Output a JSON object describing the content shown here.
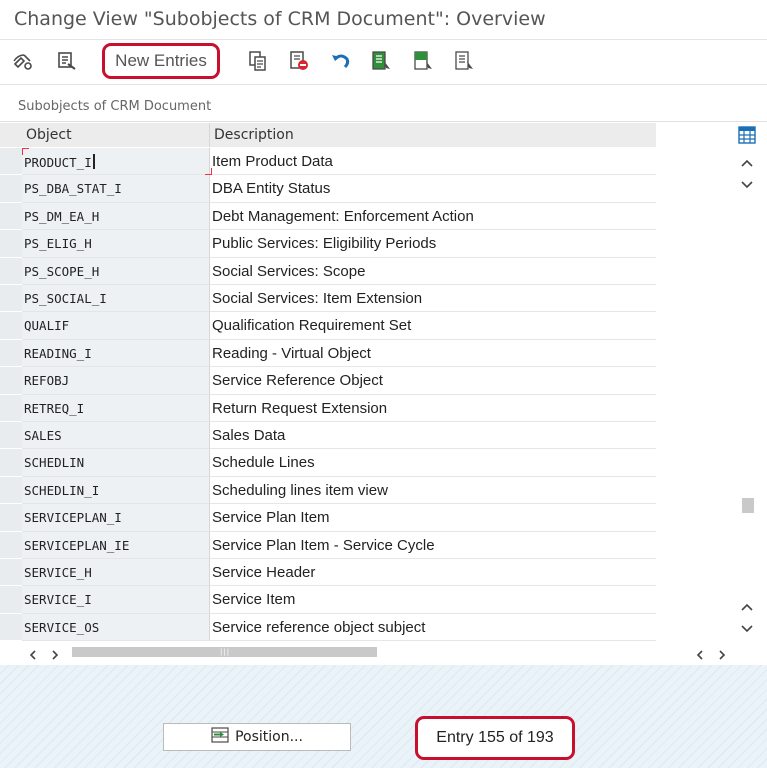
{
  "title": "Change View \"Subobjects of CRM Document\": Overview",
  "toolbar": {
    "new_entries_label": "New Entries",
    "icons": [
      "display-change-icon",
      "select-icon",
      "copy-icon",
      "delete-icon",
      "undo-icon",
      "select-all-icon",
      "select-block-icon",
      "deselect-all-icon"
    ]
  },
  "panel": {
    "title": "Subobjects of CRM Document",
    "columns": [
      "Object",
      "Description"
    ],
    "rows": [
      {
        "object": "PRODUCT_I",
        "description": "Item Product Data"
      },
      {
        "object": "PS_DBA_STAT_I",
        "description": "DBA Entity Status"
      },
      {
        "object": "PS_DM_EA_H",
        "description": "Debt Management: Enforcement Action"
      },
      {
        "object": "PS_ELIG_H",
        "description": "Public Services: Eligibility Periods"
      },
      {
        "object": "PS_SCOPE_H",
        "description": "Social Services: Scope"
      },
      {
        "object": "PS_SOCIAL_I",
        "description": "Social Services: Item Extension"
      },
      {
        "object": "QUALIF",
        "description": "Qualification Requirement Set"
      },
      {
        "object": "READING_I",
        "description": "Reading - Virtual Object"
      },
      {
        "object": "REFOBJ",
        "description": "Service Reference Object"
      },
      {
        "object": "RETREQ_I",
        "description": "Return Request Extension"
      },
      {
        "object": "SALES",
        "description": "Sales Data"
      },
      {
        "object": "SCHEDLIN",
        "description": "Schedule Lines"
      },
      {
        "object": "SCHEDLIN_I",
        "description": "Scheduling lines item view"
      },
      {
        "object": "SERVICEPLAN_I",
        "description": "Service Plan Item"
      },
      {
        "object": "SERVICEPLAN_IE",
        "description": "Service Plan Item - Service Cycle"
      },
      {
        "object": "SERVICE_H",
        "description": "Service Header"
      },
      {
        "object": "SERVICE_I",
        "description": "Service Item"
      },
      {
        "object": "SERVICE_OS",
        "description": "Service reference object subject"
      }
    ]
  },
  "footer": {
    "position_label": "Position...",
    "entry_text": "Entry 155 of 193"
  },
  "colors": {
    "highlight": "#c8102e",
    "header_bg": "#ececec",
    "key_column_bg": "#eef1f4"
  }
}
